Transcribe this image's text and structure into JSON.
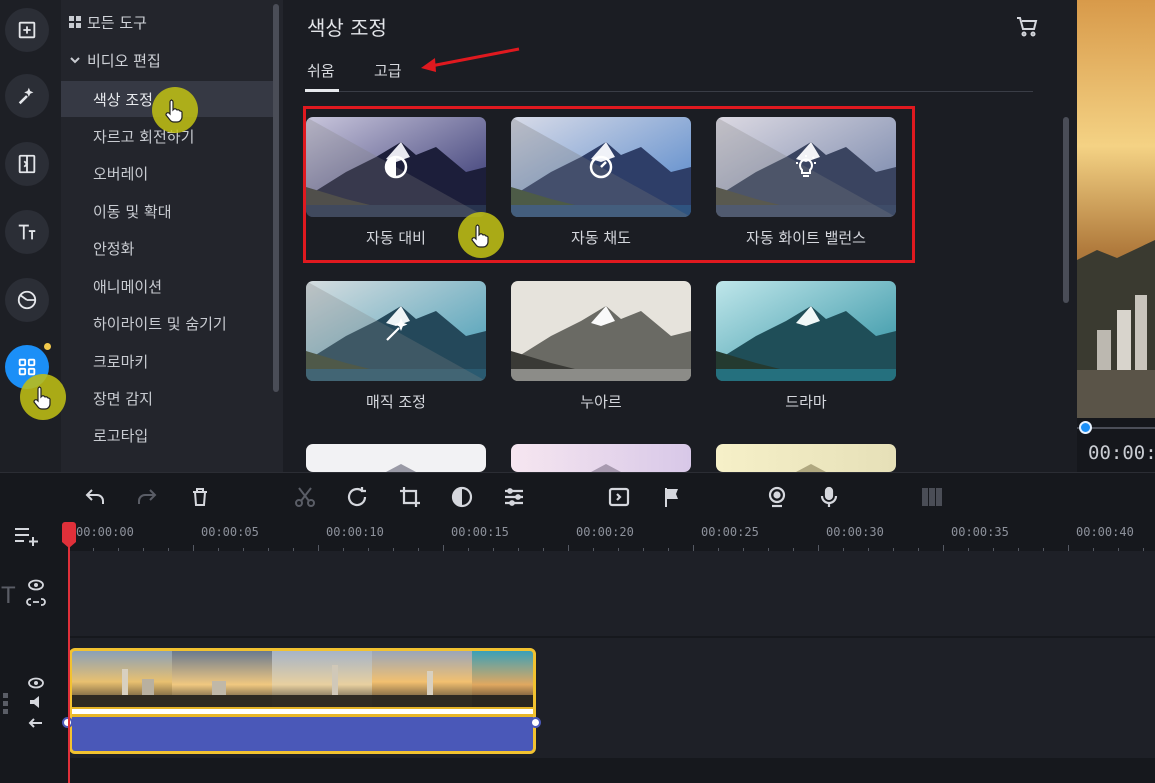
{
  "rail": {
    "items": [
      {
        "name": "import-icon"
      },
      {
        "name": "filters-magic-icon"
      },
      {
        "name": "transitions-icon"
      },
      {
        "name": "titles-icon"
      },
      {
        "name": "stickers-icon"
      },
      {
        "name": "more-tools-icon",
        "active": true
      }
    ],
    "accent": "#1b8ff7",
    "badge_color": "#f2c94c"
  },
  "tools_panel": {
    "all_tools_label": "모든 도구",
    "video_edit_label": "비디오 편집",
    "items": [
      "색상 조정",
      "자르고 회전하기",
      "오버레이",
      "이동 및 확대",
      "안정화",
      "애니메이션",
      "하이라이트 및 숨기기",
      "크로마키",
      "장면 감지",
      "로고타입"
    ],
    "selected": "색상 조정"
  },
  "content": {
    "title": "색상 조정",
    "tabs": [
      "쉬움",
      "고급"
    ],
    "active_tab": "쉬움",
    "presets": [
      {
        "label": "자동 대비",
        "icon": "contrast-icon"
      },
      {
        "label": "자동 채도",
        "icon": "saturation-gauge-icon"
      },
      {
        "label": "자동 화이트 밸런스",
        "icon": "bulb-icon"
      },
      {
        "label": "매직 조정",
        "icon": "magic-wand-icon"
      },
      {
        "label": "누아르",
        "icon": ""
      },
      {
        "label": "드라마",
        "icon": ""
      }
    ]
  },
  "preview": {
    "time": "00:00:"
  },
  "timeline": {
    "toolbar": [
      "undo-icon",
      "redo-icon",
      "delete-icon",
      "cut-icon",
      "rotate-icon",
      "crop-icon",
      "color-adjust-icon",
      "clip-properties-icon",
      "transition-icon",
      "marker-flag-icon",
      "record-webcam-icon",
      "record-audio-icon",
      "audio-meter-icon"
    ],
    "ruler_labels": [
      "00:00:00",
      "00:00:05",
      "00:00:10",
      "00:00:15",
      "00:00:20",
      "00:00:25",
      "00:00:30",
      "00:00:35",
      "00:00:40"
    ],
    "highlight_color": "#e0191f",
    "clip_border_color": "#f2c230",
    "audio_color": "#4a58b8",
    "playhead_color": "#e0303a"
  }
}
